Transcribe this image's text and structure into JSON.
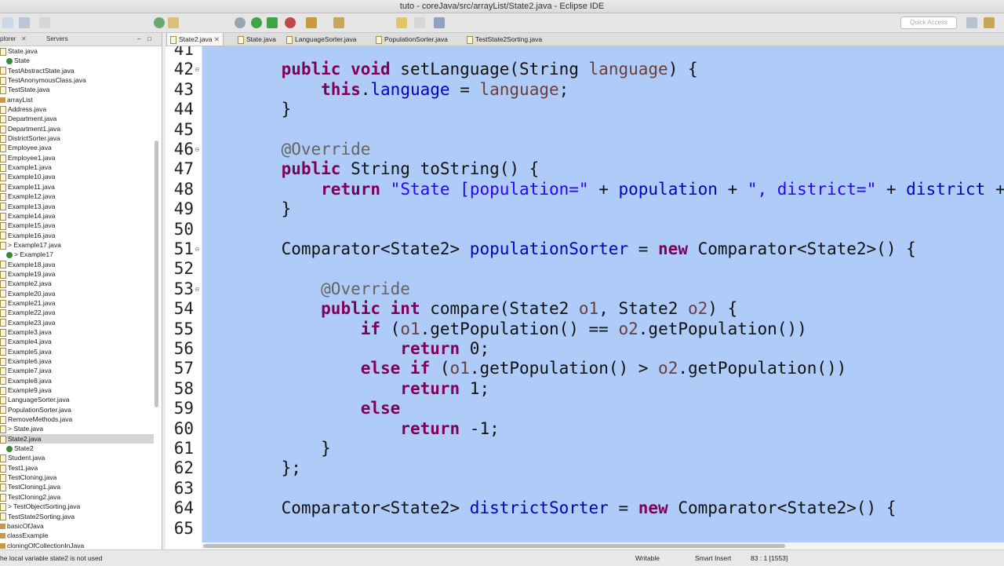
{
  "window": {
    "title": "tuto - coreJava/src/arrayList/State2.java - Eclipse IDE"
  },
  "toolbar": {
    "quick_access_placeholder": "Quick Access"
  },
  "explorer": {
    "tabs": [
      "plorer",
      "Servers"
    ],
    "items": [
      {
        "label": "State.java",
        "type": "file",
        "indent": 0
      },
      {
        "label": "State",
        "type": "class",
        "indent": 1
      },
      {
        "label": "TestAbstractState.java",
        "type": "file",
        "indent": 0
      },
      {
        "label": "TestAnonymousClass.java",
        "type": "file",
        "indent": 0
      },
      {
        "label": "TestState.java",
        "type": "file",
        "indent": 0
      },
      {
        "label": "arrayList",
        "type": "package",
        "indent": 0
      },
      {
        "label": "Address.java",
        "type": "file",
        "indent": 0
      },
      {
        "label": "Department.java",
        "type": "file",
        "indent": 0
      },
      {
        "label": "Department1.java",
        "type": "file",
        "indent": 0
      },
      {
        "label": "DistrictSorter.java",
        "type": "file",
        "indent": 0
      },
      {
        "label": "Employee.java",
        "type": "file",
        "indent": 0
      },
      {
        "label": "Employee1.java",
        "type": "file",
        "indent": 0
      },
      {
        "label": "Example1.java",
        "type": "file",
        "indent": 0
      },
      {
        "label": "Example10.java",
        "type": "file",
        "indent": 0
      },
      {
        "label": "Example11.java",
        "type": "file",
        "indent": 0
      },
      {
        "label": "Example12.java",
        "type": "file",
        "indent": 0
      },
      {
        "label": "Example13.java",
        "type": "file",
        "indent": 0
      },
      {
        "label": "Example14.java",
        "type": "file",
        "indent": 0
      },
      {
        "label": "Example15.java",
        "type": "file",
        "indent": 0
      },
      {
        "label": "Example16.java",
        "type": "file",
        "indent": 0
      },
      {
        "label": "> Example17.java",
        "type": "file",
        "indent": 0
      },
      {
        "label": "> Example17",
        "type": "class",
        "indent": 1
      },
      {
        "label": "Example18.java",
        "type": "file",
        "indent": 0
      },
      {
        "label": "Example19.java",
        "type": "file",
        "indent": 0
      },
      {
        "label": "Example2.java",
        "type": "file",
        "indent": 0
      },
      {
        "label": "Example20.java",
        "type": "file",
        "indent": 0
      },
      {
        "label": "Example21.java",
        "type": "file",
        "indent": 0
      },
      {
        "label": "Example22.java",
        "type": "file",
        "indent": 0
      },
      {
        "label": "Example23.java",
        "type": "file",
        "indent": 0
      },
      {
        "label": "Example3.java",
        "type": "file",
        "indent": 0
      },
      {
        "label": "Example4.java",
        "type": "file",
        "indent": 0
      },
      {
        "label": "Example5.java",
        "type": "file",
        "indent": 0
      },
      {
        "label": "Example6.java",
        "type": "file",
        "indent": 0
      },
      {
        "label": "Example7.java",
        "type": "file",
        "indent": 0
      },
      {
        "label": "Example8.java",
        "type": "file",
        "indent": 0
      },
      {
        "label": "Example9.java",
        "type": "file",
        "indent": 0
      },
      {
        "label": "LanguageSorter.java",
        "type": "file",
        "indent": 0
      },
      {
        "label": "PopulationSorter.java",
        "type": "file",
        "indent": 0
      },
      {
        "label": "RemoveMethods.java",
        "type": "file",
        "indent": 0
      },
      {
        "label": "> State.java",
        "type": "file",
        "indent": 0
      },
      {
        "label": "State2.java",
        "type": "file",
        "indent": 0,
        "selected": true
      },
      {
        "label": "State2",
        "type": "class",
        "indent": 1
      },
      {
        "label": "Student.java",
        "type": "file",
        "indent": 0
      },
      {
        "label": "Test1.java",
        "type": "file",
        "indent": 0
      },
      {
        "label": "TestCloning.java",
        "type": "file",
        "indent": 0
      },
      {
        "label": "TestCloning1.java",
        "type": "file",
        "indent": 0
      },
      {
        "label": "TestCloning2.java",
        "type": "file",
        "indent": 0
      },
      {
        "label": "> TestObjectSorting.java",
        "type": "file",
        "indent": 0
      },
      {
        "label": "TestState2Sorting.java",
        "type": "file",
        "indent": 0
      },
      {
        "label": "basicOfJava",
        "type": "package",
        "indent": 0
      },
      {
        "label": "classExample",
        "type": "package",
        "indent": 0
      },
      {
        "label": "cloningOfCollectionInJava",
        "type": "package",
        "indent": 0
      }
    ]
  },
  "editor": {
    "tabs": [
      {
        "label": "State2.java",
        "active": true,
        "closable": true
      },
      {
        "label": "State.java"
      },
      {
        "label": "LanguageSorter.java"
      },
      {
        "label": "PopulationSorter.java"
      },
      {
        "label": "TestState2Sorting.java"
      }
    ],
    "lines": [
      {
        "n": "41",
        "t": []
      },
      {
        "n": "42",
        "t": [
          [
            "",
            "    "
          ],
          [
            "kw",
            "public void"
          ],
          [
            "",
            " setLanguage(String "
          ],
          [
            "lv",
            "language"
          ],
          [
            "",
            ") {"
          ]
        ]
      },
      {
        "n": "43",
        "t": [
          [
            "",
            "        "
          ],
          [
            "kw",
            "this"
          ],
          [
            "",
            "."
          ],
          [
            "fd",
            "language"
          ],
          [
            "",
            " = "
          ],
          [
            "lv",
            "language"
          ],
          [
            "",
            ";"
          ]
        ]
      },
      {
        "n": "44",
        "t": [
          [
            "",
            "    }"
          ]
        ]
      },
      {
        "n": "45",
        "t": []
      },
      {
        "n": "46",
        "t": [
          [
            "",
            "    "
          ],
          [
            "an",
            "@Override"
          ]
        ]
      },
      {
        "n": "47",
        "t": [
          [
            "",
            "    "
          ],
          [
            "kw",
            "public"
          ],
          [
            "",
            " String toString() {"
          ]
        ]
      },
      {
        "n": "48",
        "t": [
          [
            "",
            "        "
          ],
          [
            "kw",
            "return"
          ],
          [
            "",
            " "
          ],
          [
            "st",
            "\"State [population=\""
          ],
          [
            "",
            " + "
          ],
          [
            "fd",
            "population"
          ],
          [
            "",
            " + "
          ],
          [
            "st",
            "\", district=\""
          ],
          [
            "",
            " + "
          ],
          [
            "fd",
            "district"
          ],
          [
            "",
            " +"
          ]
        ]
      },
      {
        "n": "49",
        "t": [
          [
            "",
            "    }"
          ]
        ]
      },
      {
        "n": "50",
        "t": []
      },
      {
        "n": "51",
        "t": [
          [
            "",
            "    Comparator<State2> "
          ],
          [
            "fd",
            "populationSorter"
          ],
          [
            "",
            " = "
          ],
          [
            "kw",
            "new"
          ],
          [
            "",
            " Comparator<State2>() {"
          ]
        ]
      },
      {
        "n": "52",
        "t": []
      },
      {
        "n": "53",
        "t": [
          [
            "",
            "        "
          ],
          [
            "an",
            "@Override"
          ]
        ]
      },
      {
        "n": "54",
        "t": [
          [
            "",
            "        "
          ],
          [
            "kw",
            "public int"
          ],
          [
            "",
            " compare(State2 "
          ],
          [
            "lv",
            "o1"
          ],
          [
            "",
            ", State2 "
          ],
          [
            "lv",
            "o2"
          ],
          [
            "",
            ") {"
          ]
        ]
      },
      {
        "n": "55",
        "t": [
          [
            "",
            "            "
          ],
          [
            "kw",
            "if"
          ],
          [
            "",
            " ("
          ],
          [
            "lv",
            "o1"
          ],
          [
            "",
            ".getPopulation() == "
          ],
          [
            "lv",
            "o2"
          ],
          [
            "",
            ".getPopulation())"
          ]
        ]
      },
      {
        "n": "56",
        "t": [
          [
            "",
            "                "
          ],
          [
            "kw",
            "return"
          ],
          [
            "",
            " 0;"
          ]
        ]
      },
      {
        "n": "57",
        "t": [
          [
            "",
            "            "
          ],
          [
            "kw",
            "else if"
          ],
          [
            "",
            " ("
          ],
          [
            "lv",
            "o1"
          ],
          [
            "",
            ".getPopulation() > "
          ],
          [
            "lv",
            "o2"
          ],
          [
            "",
            ".getPopulation())"
          ]
        ]
      },
      {
        "n": "58",
        "t": [
          [
            "",
            "                "
          ],
          [
            "kw",
            "return"
          ],
          [
            "",
            " 1;"
          ]
        ]
      },
      {
        "n": "59",
        "t": [
          [
            "",
            "            "
          ],
          [
            "kw",
            "else"
          ]
        ]
      },
      {
        "n": "60",
        "t": [
          [
            "",
            "                "
          ],
          [
            "kw",
            "return"
          ],
          [
            "",
            " -1;"
          ]
        ]
      },
      {
        "n": "61",
        "t": [
          [
            "",
            "        }"
          ]
        ]
      },
      {
        "n": "62",
        "t": [
          [
            "",
            "    };"
          ]
        ]
      },
      {
        "n": "63",
        "t": []
      },
      {
        "n": "64",
        "t": [
          [
            "",
            "    Comparator<State2> "
          ],
          [
            "fd",
            "districtSorter"
          ],
          [
            "",
            " = "
          ],
          [
            "kw",
            "new"
          ],
          [
            "",
            " Comparator<State2>() {"
          ]
        ]
      },
      {
        "n": "65",
        "t": []
      }
    ]
  },
  "status": {
    "message": "he local variable state2 is not used",
    "mode": "Writable",
    "insert": "Smart Insert",
    "position": "83 : 1 [1553]"
  },
  "colors": {
    "selection": "#aeccf7",
    "keyword": "#7f0055",
    "string": "#2a00ff",
    "field": "#0000c0",
    "annotation": "#646464"
  }
}
